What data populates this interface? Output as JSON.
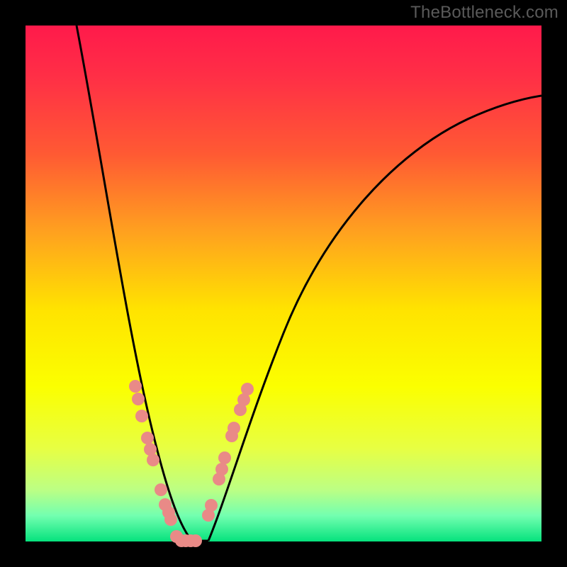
{
  "watermark": "TheBottleneck.com",
  "chart_data": {
    "type": "line",
    "title": "",
    "xlabel": "",
    "ylabel": "",
    "xlim": [
      0,
      100
    ],
    "ylim": [
      0,
      100
    ],
    "gradient_stops": [
      {
        "offset": 0.0,
        "color": "#ff1a4b"
      },
      {
        "offset": 0.1,
        "color": "#ff2f46"
      },
      {
        "offset": 0.25,
        "color": "#ff5a33"
      },
      {
        "offset": 0.4,
        "color": "#ffa11f"
      },
      {
        "offset": 0.55,
        "color": "#ffe300"
      },
      {
        "offset": 0.7,
        "color": "#fbff00"
      },
      {
        "offset": 0.82,
        "color": "#e7ff43"
      },
      {
        "offset": 0.9,
        "color": "#bcff84"
      },
      {
        "offset": 0.95,
        "color": "#73ffb0"
      },
      {
        "offset": 1.0,
        "color": "#05e27d"
      }
    ],
    "series": [
      {
        "name": "curve-left",
        "approx_points": [
          {
            "x": 10,
            "y": 100
          },
          {
            "x": 13,
            "y": 80
          },
          {
            "x": 16,
            "y": 60
          },
          {
            "x": 19,
            "y": 40
          },
          {
            "x": 22,
            "y": 25
          },
          {
            "x": 25,
            "y": 12
          },
          {
            "x": 28,
            "y": 3
          },
          {
            "x": 30,
            "y": 0
          }
        ]
      },
      {
        "name": "curve-right",
        "approx_points": [
          {
            "x": 33,
            "y": 0
          },
          {
            "x": 36,
            "y": 8
          },
          {
            "x": 40,
            "y": 20
          },
          {
            "x": 46,
            "y": 35
          },
          {
            "x": 54,
            "y": 50
          },
          {
            "x": 64,
            "y": 63
          },
          {
            "x": 76,
            "y": 74
          },
          {
            "x": 90,
            "y": 82
          },
          {
            "x": 100,
            "y": 86
          }
        ]
      }
    ],
    "markers": {
      "color": "#e98a87",
      "radius_px": 9,
      "left_branch": [
        {
          "x": 21.3,
          "y": 30.0
        },
        {
          "x": 21.8,
          "y": 27.5
        },
        {
          "x": 22.5,
          "y": 24.2
        },
        {
          "x": 23.6,
          "y": 20.0
        },
        {
          "x": 24.2,
          "y": 17.8
        },
        {
          "x": 24.7,
          "y": 15.8
        },
        {
          "x": 26.3,
          "y": 10.0
        },
        {
          "x": 27.1,
          "y": 7.0
        },
        {
          "x": 27.7,
          "y": 5.6
        },
        {
          "x": 28.1,
          "y": 4.2
        },
        {
          "x": 29.2,
          "y": 1.0
        },
        {
          "x": 30.2,
          "y": 0.0
        },
        {
          "x": 31.0,
          "y": 0.0
        },
        {
          "x": 32.0,
          "y": 0.0
        },
        {
          "x": 33.0,
          "y": 0.0
        }
      ],
      "right_branch": [
        {
          "x": 35.4,
          "y": 5.0
        },
        {
          "x": 36.0,
          "y": 7.0
        },
        {
          "x": 37.5,
          "y": 12.0
        },
        {
          "x": 38.0,
          "y": 14.0
        },
        {
          "x": 38.6,
          "y": 16.2
        },
        {
          "x": 40.0,
          "y": 20.5
        },
        {
          "x": 40.4,
          "y": 22.0
        },
        {
          "x": 41.6,
          "y": 25.5
        },
        {
          "x": 42.3,
          "y": 27.5
        },
        {
          "x": 43.0,
          "y": 29.5
        }
      ]
    }
  }
}
